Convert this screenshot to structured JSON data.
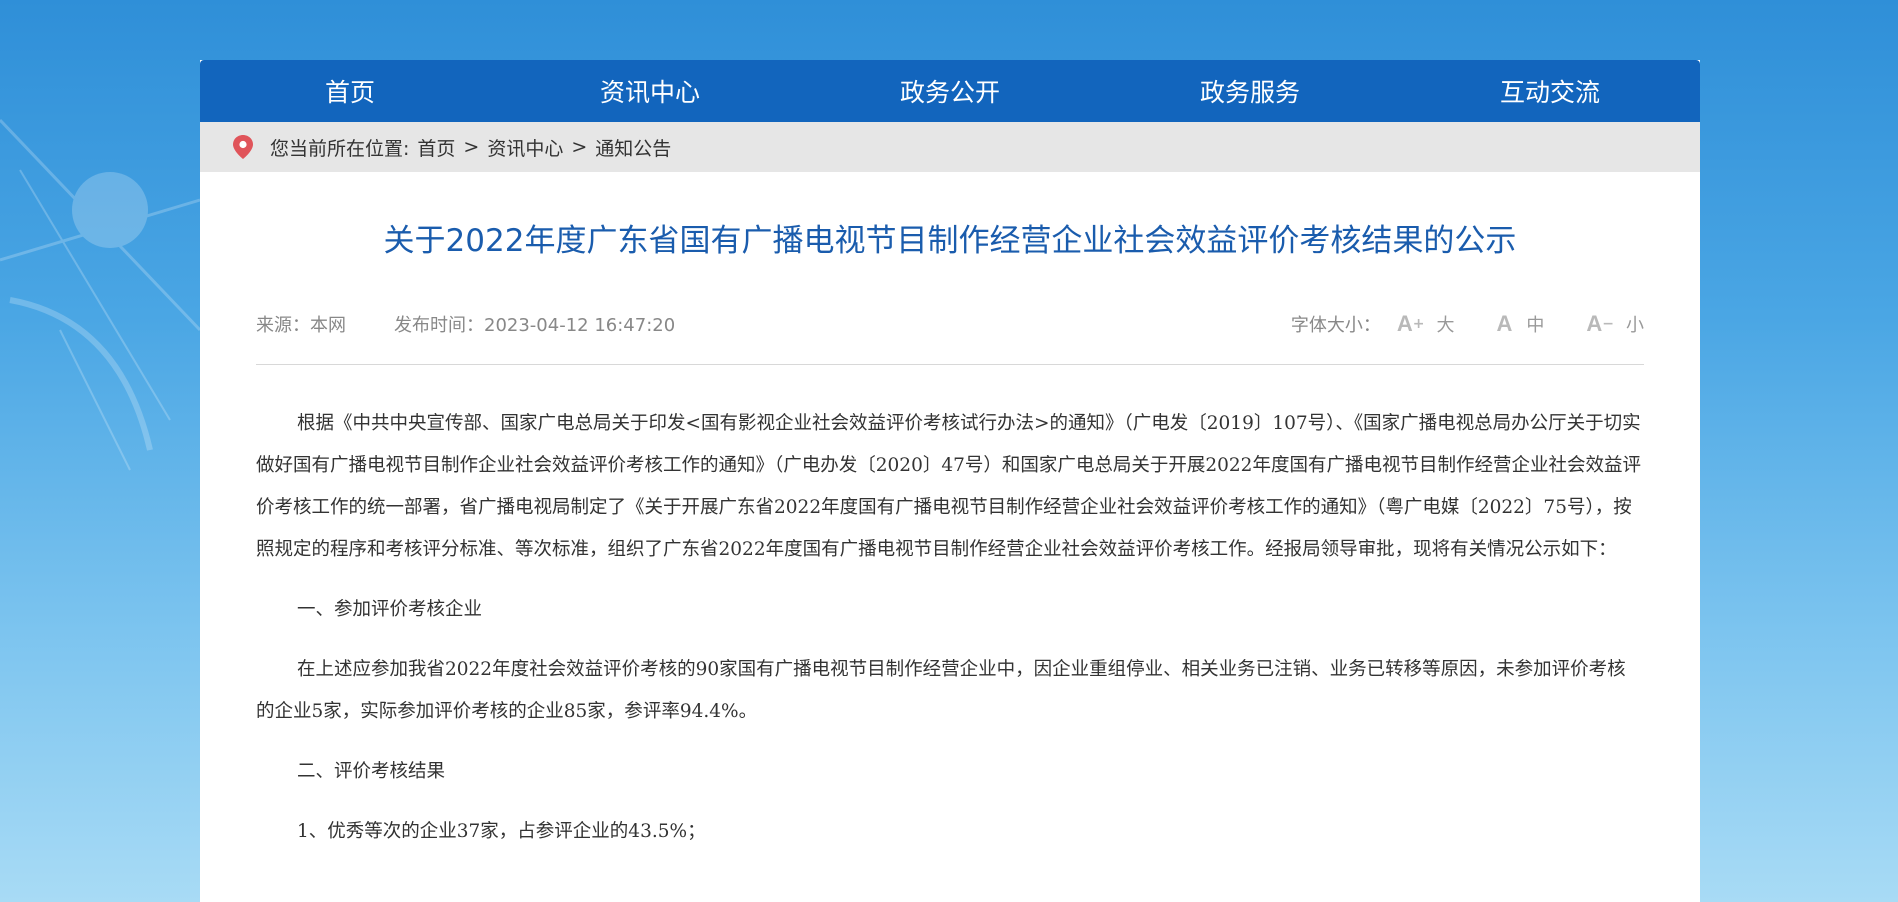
{
  "nav": {
    "items": [
      "首页",
      "资讯中心",
      "政务公开",
      "政务服务",
      "互动交流"
    ]
  },
  "breadcrumb": {
    "label": "您当前所在位置:",
    "items": [
      "首页",
      "资讯中心",
      "通知公告"
    ],
    "separator": ">"
  },
  "article": {
    "title": "关于2022年度广东省国有广播电视节目制作经营企业社会效益评价考核结果的公示",
    "source": "来源：本网",
    "publish_time": "发布时间：2023-04-12 16:47:20",
    "font_size_label": "字体大小：",
    "font_sizes": {
      "large": {
        "glyph": "A",
        "sup": "+",
        "label": "大"
      },
      "medium": {
        "glyph": "A",
        "sup": "",
        "label": "中"
      },
      "small": {
        "glyph": "A",
        "sup": "−",
        "label": "小"
      }
    },
    "paragraphs": [
      "根据《中共中央宣传部、国家广电总局关于印发<国有影视企业社会效益评价考核试行办法>的通知》（广电发〔2019〕107号）、《国家广播电视总局办公厅关于切实做好国有广播电视节目制作企业社会效益评价考核工作的通知》（广电办发〔2020〕47号）和国家广电总局关于开展2022年度国有广播电视节目制作经营企业社会效益评价考核工作的统一部署，省广播电视局制定了《关于开展广东省2022年度国有广播电视节目制作经营企业社会效益评价考核工作的通知》（粤广电媒〔2022〕75号），按照规定的程序和考核评分标准、等次标准，组织了广东省2022年度国有广播电视节目制作经营企业社会效益评价考核工作。经报局领导审批，现将有关情况公示如下：",
      "一、参加评价考核企业",
      "在上述应参加我省2022年度社会效益评价考核的90家国有广播电视节目制作经营企业中，因企业重组停业、相关业务已注销、业务已转移等原因，未参加评价考核的企业5家，实际参加评价考核的企业85家，参评率94.4%。",
      "二、评价考核结果",
      "1、优秀等次的企业37家，占参评企业的43.5%；"
    ]
  },
  "colors": {
    "nav_bg": "#1265bd",
    "title": "#1a5cad",
    "breadcrumb_bg": "#e6e6e6",
    "pin": "#e0545a"
  }
}
